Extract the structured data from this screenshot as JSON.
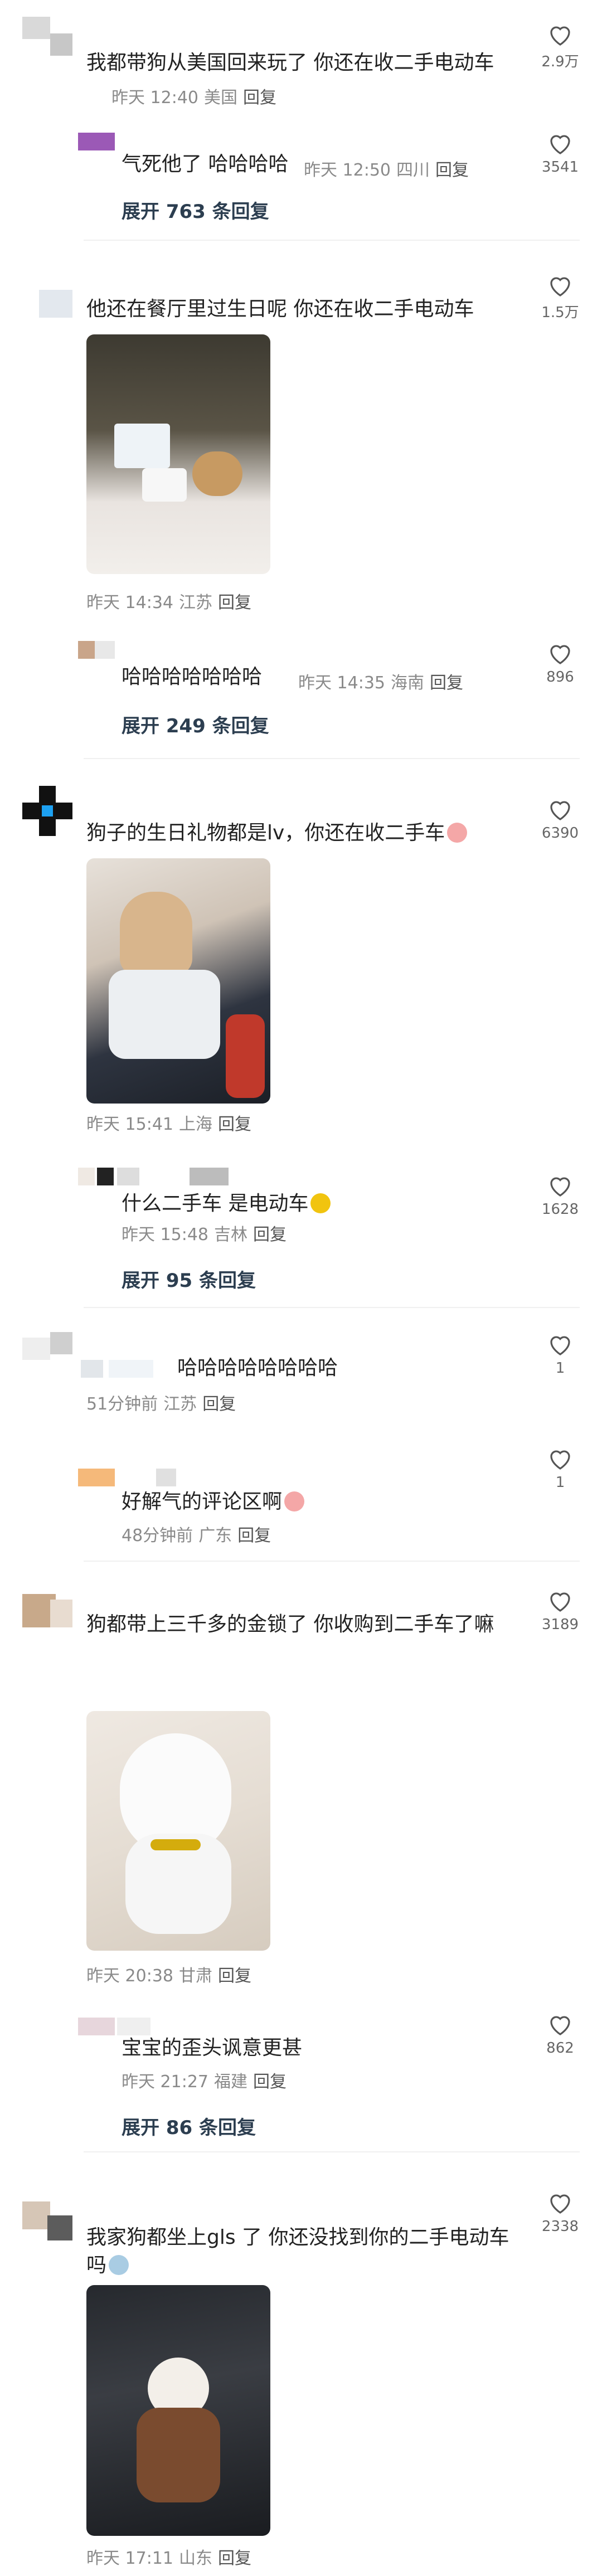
{
  "threads": [
    {
      "comment": {
        "text": "我都带狗从美国回来玩了 你还在收二手电动车",
        "time": "昨天 12:40",
        "loc": "美国",
        "reply": "回复",
        "likes": "2.9万"
      },
      "replies": [
        {
          "text": "气死他了 哈哈哈哈",
          "time": "昨天 12:50",
          "loc": "四川",
          "reply": "回复",
          "likes": "3541"
        }
      ],
      "expand": "展开 763 条回复"
    },
    {
      "comment": {
        "text": "他还在餐厅里过生日呢 你还在收二手电动车",
        "time": "昨天 14:34",
        "loc": "江苏",
        "reply": "回复",
        "likes": "1.5万",
        "photo": "birthday-cake-photo"
      },
      "replies": [
        {
          "text": "哈哈哈哈哈哈哈",
          "time": "昨天 14:35",
          "loc": "海南",
          "reply": "回复",
          "likes": "896"
        }
      ],
      "expand": "展开 249 条回复"
    },
    {
      "comment": {
        "text": "狗子的生日礼物都是lv，你还在收二手车",
        "time": "昨天 15:41",
        "loc": "上海",
        "reply": "回复",
        "likes": "6390",
        "photo": "dog-in-bag-photo"
      },
      "replies": [
        {
          "text": "什么二手车 是电动车",
          "time": "昨天 15:48",
          "loc": "吉林",
          "reply": "回复",
          "likes": "1628"
        }
      ],
      "expand": "展开 95 条回复"
    },
    {
      "comment": {
        "text": "哈哈哈哈哈哈哈哈",
        "time": "51分钟前",
        "loc": "江苏",
        "reply": "回复",
        "likes": "1"
      },
      "replies": [
        {
          "text": "好解气的评论区啊",
          "time": "48分钟前",
          "loc": "广东",
          "reply": "回复",
          "likes": "1"
        }
      ],
      "expand": ""
    },
    {
      "comment": {
        "text": "狗都带上三千多的金锁了 你收购到二手车了嘛",
        "time": "昨天 20:38",
        "loc": "甘肃",
        "reply": "回复",
        "likes": "3189",
        "photo": "white-dog-photo"
      },
      "replies": [
        {
          "text": "宝宝的歪头讽意更甚",
          "time": "昨天 21:27",
          "loc": "福建",
          "reply": "回复",
          "likes": "862"
        }
      ],
      "expand": "展开 86 条回复"
    },
    {
      "comment": {
        "text": "我家狗都坐上gls 了 你还没找到你的二手电动车吗",
        "time": "昨天 17:11",
        "loc": "山东",
        "reply": "回复",
        "likes": "2338",
        "photo": "dog-in-car-photo"
      },
      "replies": [],
      "expand": ""
    }
  ],
  "colors": {
    "accent": "#2c3e50",
    "meta": "#8a8a8a",
    "separator": "#f0f0f0"
  },
  "icons": {
    "like": "heart-outline-icon"
  }
}
